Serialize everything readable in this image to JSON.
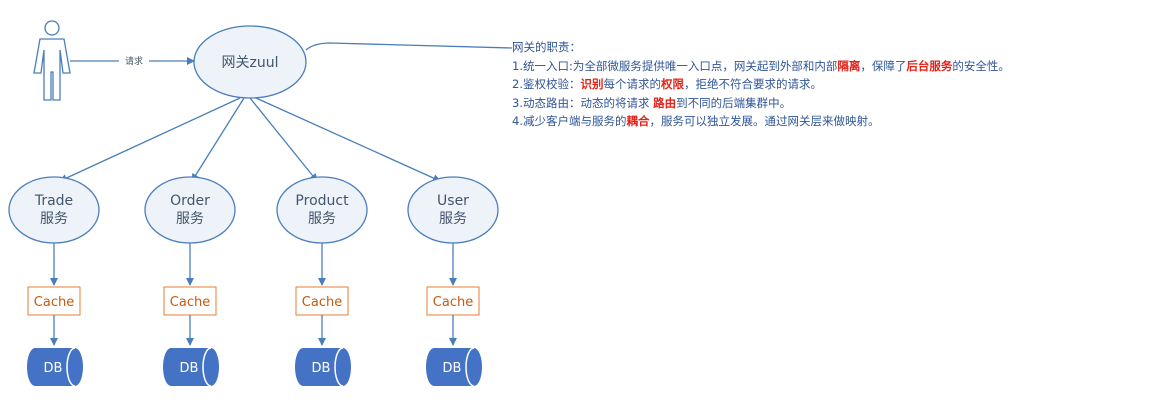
{
  "user_label": "请求",
  "gateway": {
    "label": "网关zuul"
  },
  "services": [
    {
      "name": "Trade",
      "sub": "服务"
    },
    {
      "name": "Order",
      "sub": "服务"
    },
    {
      "name": "Product",
      "sub": "服务"
    },
    {
      "name": "User",
      "sub": "服务"
    }
  ],
  "cache_label": "Cache",
  "db_label": "DB",
  "notes": {
    "title": "网关的职责：",
    "line1": {
      "a": "1.统一入口:为全部微服务提供唯一入口点，网关起到外部和内部",
      "h1": "隔离",
      "b": "，保障了",
      "h2": "后台服务",
      "c": "的安全性。"
    },
    "line2": {
      "a": "2.鉴权校验：",
      "h1": "识别",
      "b": "每个请求的",
      "h2": "权限",
      "c": "，拒绝不符合要求的请求。"
    },
    "line3": {
      "a": "3.动态路由：动态的将请求 ",
      "h1": "路由",
      "b": "到不同的后端集群中。"
    },
    "line4": {
      "a": "4.减少客户端与服务的",
      "h1": "耦合",
      "b": "，服务可以独立发展。通过网关层来做映射。"
    }
  },
  "colors": {
    "line": "#4a7ebb",
    "ellipse_fill": "#eef3fa",
    "cache_border": "#ed7d31",
    "db_fill": "#4472c4",
    "highlight": "#e2231a"
  }
}
